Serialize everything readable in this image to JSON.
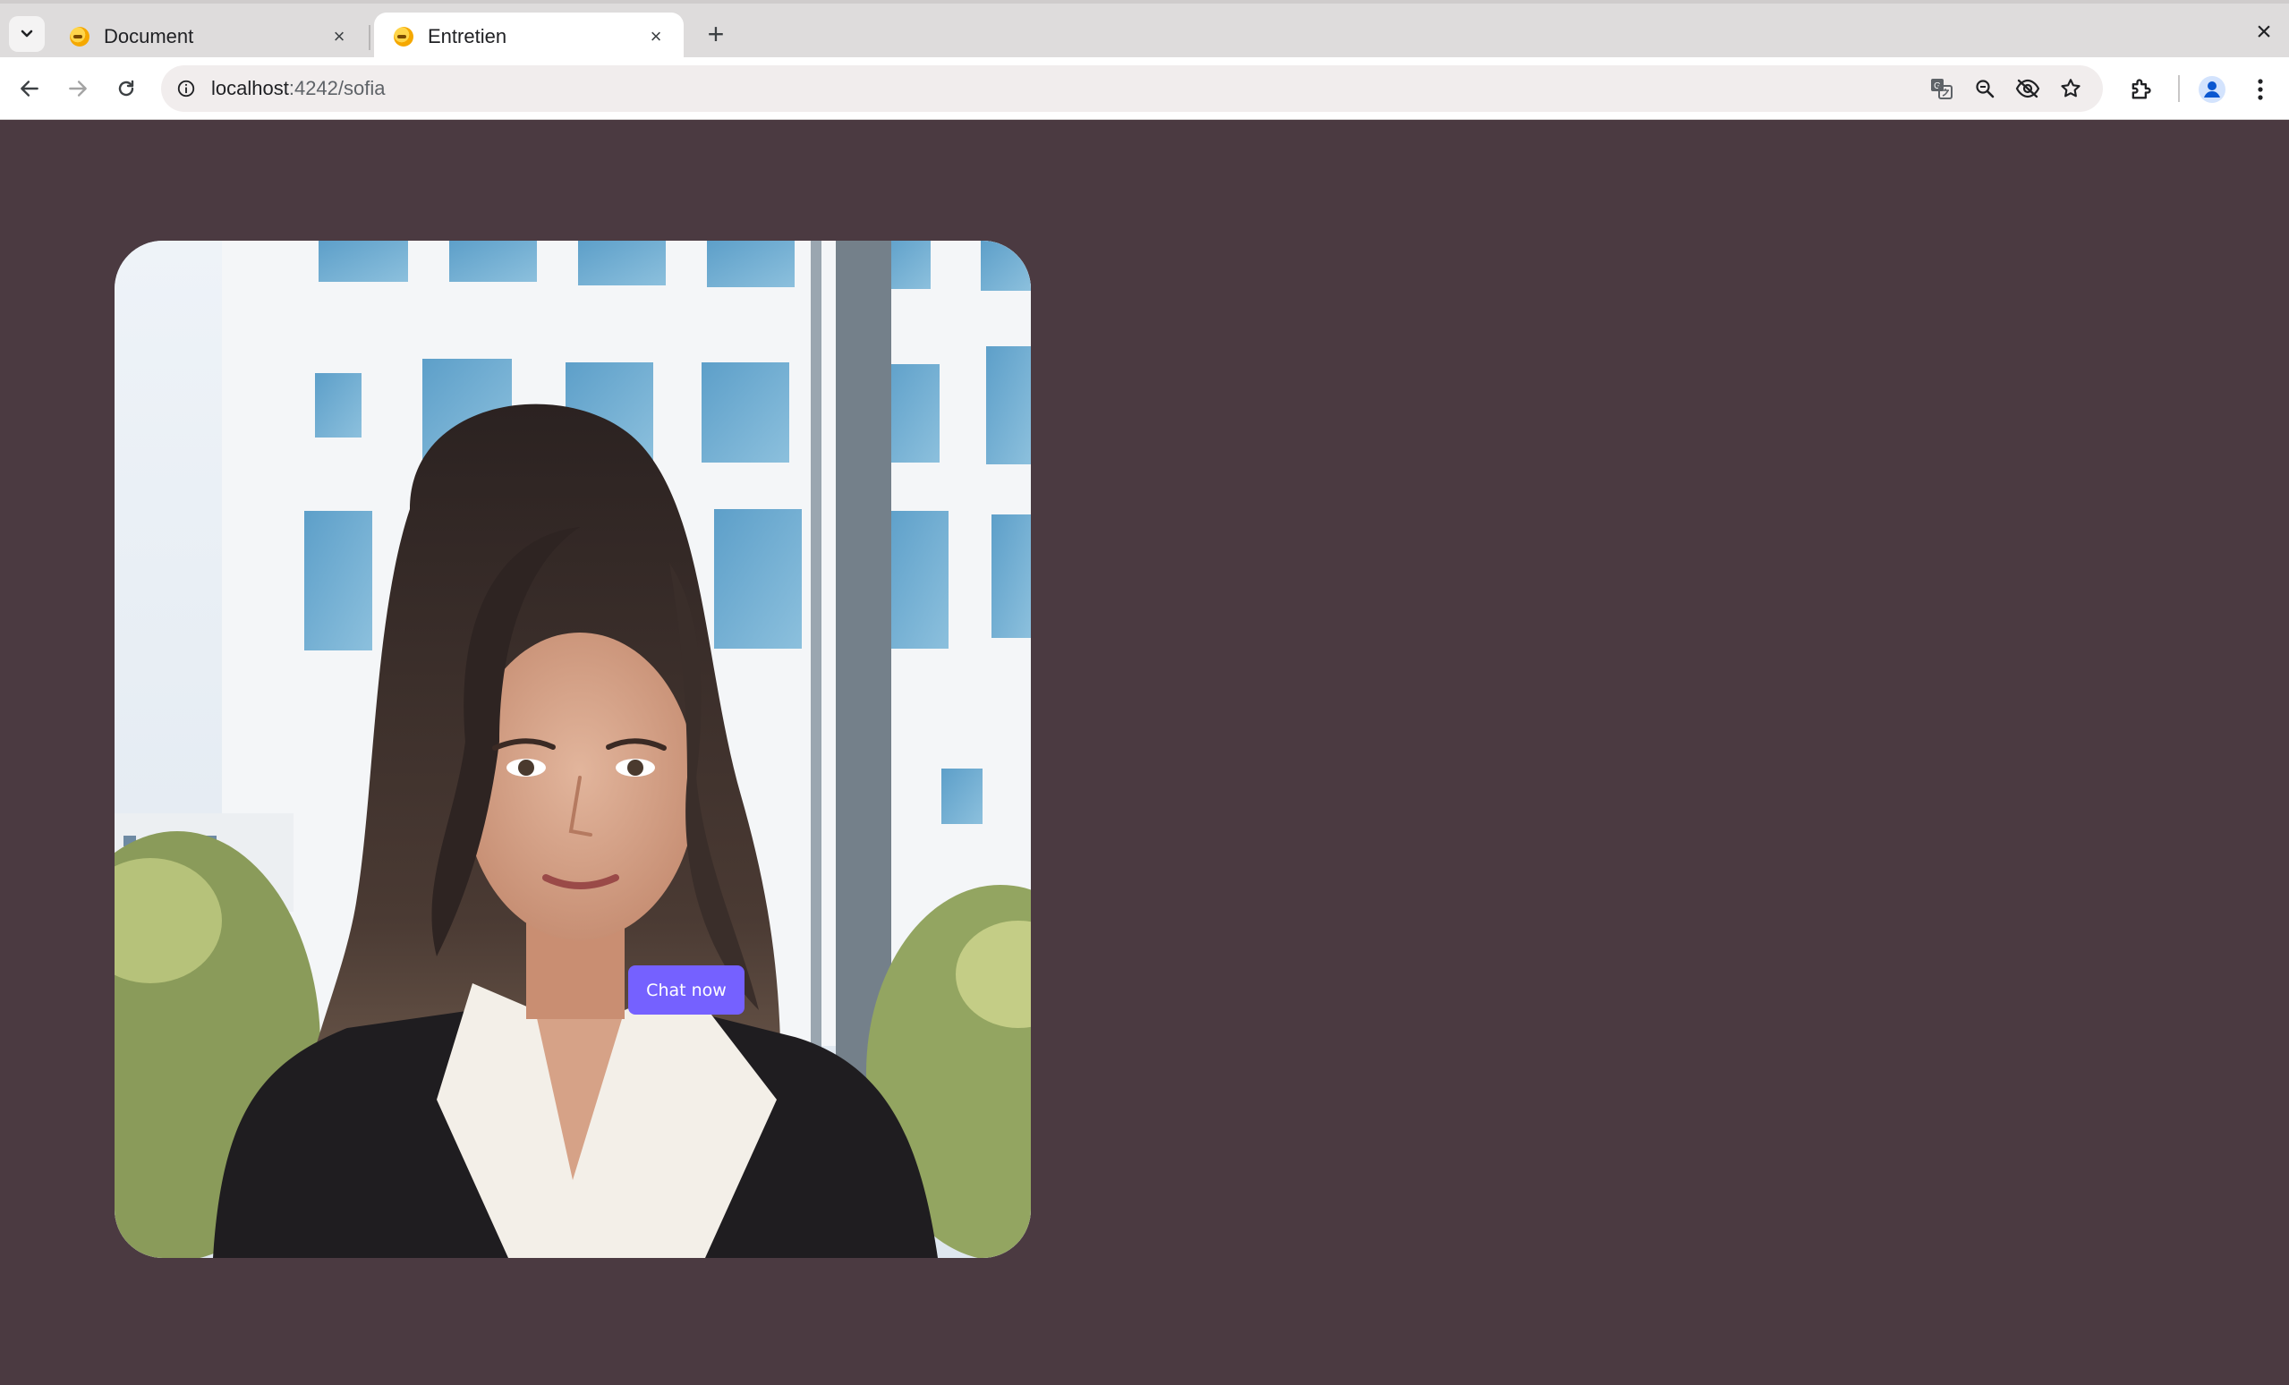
{
  "browser": {
    "tabs": [
      {
        "title": "Document",
        "active": false
      },
      {
        "title": "Entretien",
        "active": true
      }
    ],
    "close_glyph": "×",
    "new_tab_glyph": "+",
    "address": {
      "host": "localhost",
      "rest": ":4242/sofia"
    },
    "icons": [
      "tab-search-icon",
      "back-icon",
      "forward-icon",
      "reload-icon",
      "site-info-icon",
      "translate-icon",
      "zoom-icon",
      "tracking-protection-icon",
      "bookmark-star-icon",
      "extensions-icon",
      "profile-icon",
      "menu-icon"
    ]
  },
  "page": {
    "background": "#4b3a41",
    "chat_button_label": "Chat now",
    "accent": "#7561ff"
  }
}
